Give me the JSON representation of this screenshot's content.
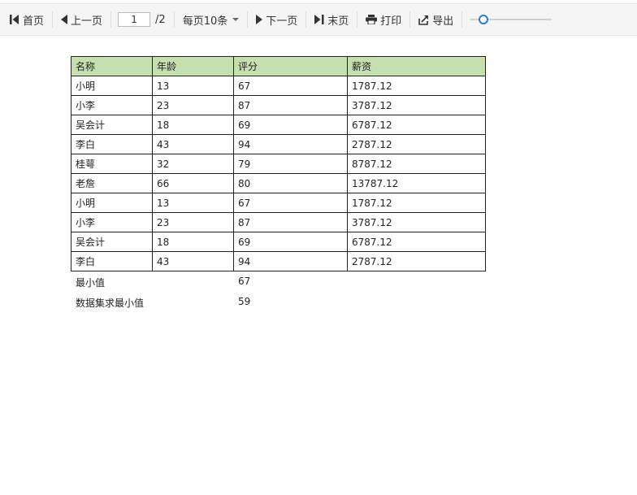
{
  "toolbar": {
    "first_label": "首页",
    "prev_label": "上一页",
    "page_value": "1",
    "total_pages": "/2",
    "per_page_label": "每页10条",
    "next_label": "下一页",
    "last_label": "末页",
    "print_label": "打印",
    "export_label": "导出",
    "zoom_level": 0.1
  },
  "table": {
    "headers": [
      "名称",
      "年龄",
      "评分",
      "薪资"
    ],
    "rows": [
      [
        "小明",
        "13",
        "67",
        "1787.12"
      ],
      [
        "小李",
        "23",
        "87",
        "3787.12"
      ],
      [
        "吴会计",
        "18",
        "69",
        "6787.12"
      ],
      [
        "李白",
        "43",
        "94",
        "2787.12"
      ],
      [
        "桂萼",
        "32",
        "79",
        "8787.12"
      ],
      [
        "老詹",
        "66",
        "80",
        "13787.12"
      ],
      [
        "小明",
        "13",
        "67",
        "1787.12"
      ],
      [
        "小李",
        "23",
        "87",
        "3787.12"
      ],
      [
        "吴会计",
        "18",
        "69",
        "6787.12"
      ],
      [
        "李白",
        "43",
        "94",
        "2787.12"
      ]
    ]
  },
  "summary": [
    {
      "label": "最小值",
      "value": "67"
    },
    {
      "label": "数据集求最小值",
      "value": "59"
    }
  ]
}
